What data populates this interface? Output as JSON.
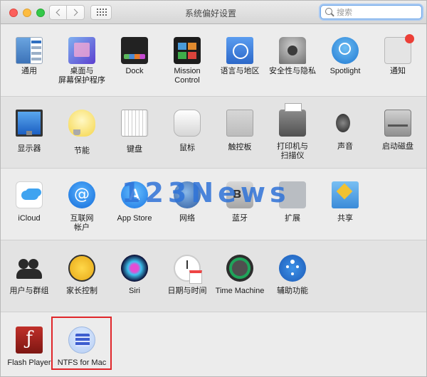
{
  "window": {
    "title": "系统偏好设置"
  },
  "search": {
    "placeholder": "搜索"
  },
  "sections": [
    {
      "panes": [
        {
          "label": "通用",
          "icon": "general-icon"
        },
        {
          "label": "桌面与\n屏幕保护程序",
          "icon": "desktop-screensaver-icon"
        },
        {
          "label": "Dock",
          "icon": "dock-icon"
        },
        {
          "label": "Mission\nControl",
          "icon": "mission-control-icon"
        },
        {
          "label": "语言与地区",
          "icon": "language-region-icon"
        },
        {
          "label": "安全性与隐私",
          "icon": "security-privacy-icon"
        },
        {
          "label": "Spotlight",
          "icon": "spotlight-icon"
        },
        {
          "label": "通知",
          "icon": "notifications-icon"
        }
      ]
    },
    {
      "panes": [
        {
          "label": "显示器",
          "icon": "displays-icon"
        },
        {
          "label": "节能",
          "icon": "energy-saver-icon"
        },
        {
          "label": "键盘",
          "icon": "keyboard-icon"
        },
        {
          "label": "鼠标",
          "icon": "mouse-icon"
        },
        {
          "label": "触控板",
          "icon": "trackpad-icon"
        },
        {
          "label": "打印机与\n扫描仪",
          "icon": "printers-scanners-icon"
        },
        {
          "label": "声音",
          "icon": "sound-icon"
        },
        {
          "label": "启动磁盘",
          "icon": "startup-disk-icon"
        }
      ]
    },
    {
      "panes": [
        {
          "label": "iCloud",
          "icon": "icloud-icon"
        },
        {
          "label": "互联网\n帐户",
          "icon": "internet-accounts-icon"
        },
        {
          "label": "App Store",
          "icon": "app-store-icon"
        },
        {
          "label": "网络",
          "icon": "network-icon"
        },
        {
          "label": "蓝牙",
          "icon": "bluetooth-icon"
        },
        {
          "label": "扩展",
          "icon": "extensions-icon"
        },
        {
          "label": "共享",
          "icon": "sharing-icon"
        }
      ]
    },
    {
      "panes": [
        {
          "label": "用户与群组",
          "icon": "users-groups-icon"
        },
        {
          "label": "家长控制",
          "icon": "parental-controls-icon"
        },
        {
          "label": "Siri",
          "icon": "siri-icon"
        },
        {
          "label": "日期与时间",
          "icon": "date-time-icon"
        },
        {
          "label": "Time Machine",
          "icon": "time-machine-icon"
        },
        {
          "label": "辅助功能",
          "icon": "accessibility-icon"
        }
      ]
    },
    {
      "panes": [
        {
          "label": "Flash Player",
          "icon": "flash-player-icon"
        },
        {
          "label": "NTFS for Mac",
          "icon": "ntfs-for-mac-icon"
        }
      ]
    }
  ],
  "watermark": "123News",
  "colors": {
    "highlight": "#e0262a",
    "watermark": "#2f73d8",
    "search_focus": "#6ca6e8"
  }
}
